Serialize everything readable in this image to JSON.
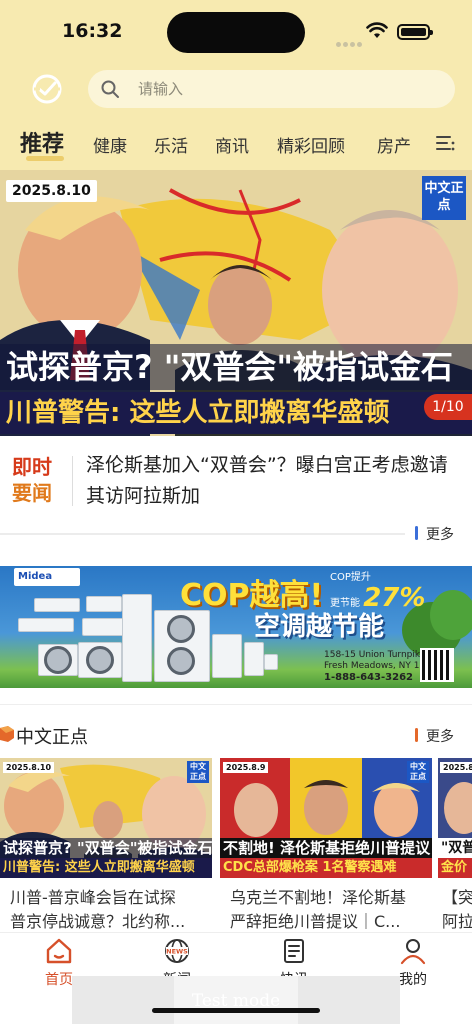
{
  "status_bar": {
    "time": "16:32"
  },
  "search": {
    "placeholder": "请输入"
  },
  "tabs": [
    {
      "label": "推荐",
      "active": true
    },
    {
      "label": "健康"
    },
    {
      "label": "乐活"
    },
    {
      "label": "商讯"
    },
    {
      "label": "精彩回顾"
    },
    {
      "label": "房产"
    }
  ],
  "hero": {
    "date": "2025.8.10",
    "brand": "中文正点",
    "title": "试探普京? \"双普会\"被指试金石",
    "subtitle": "川普警告: 这些人立即搬离华盛顿",
    "pager": "1/10"
  },
  "breaking": {
    "label_line1": "即时",
    "label_line2": "要闻",
    "text": "泽伦斯基加入“双普会”？曝白宫正考虑邀请其访阿拉斯加",
    "more": "更多"
  },
  "ad": {
    "brand": "Midea",
    "headline": "COP越高!",
    "pct_label": "COP提升",
    "pct_sub": "更节能",
    "pct": "27%",
    "sub": "空调越节能",
    "address_line1": "158-15 Union Turnpike",
    "address_line2": "Fresh Meadows, NY 11366",
    "phone": "1-888-643-3262"
  },
  "section": {
    "title": "中文正点",
    "more": "更多",
    "cards": [
      {
        "date": "2025.8.10",
        "brand": "中文正点",
        "cap1": "试探普京? \"双普会\"被指试金石",
        "cap2": "川普警告: 这些人立即搬离华盛顿",
        "title_line1": "川普-普京峰会旨在试探",
        "title_line2": "普京停战诚意？北约称..."
      },
      {
        "date": "2025.8.9",
        "brand": "中文正点",
        "cap1": "不割地! 泽伦斯基拒绝川普提议",
        "cap2": "CDC总部爆枪案 1名警察遇难",
        "title_line1": "乌克兰不割地！泽伦斯基",
        "title_line2": "严辞拒绝川普提议｜C..."
      },
      {
        "date": "2025.8",
        "brand": "中文正点",
        "cap1": "\"双普",
        "cap2": "金价",
        "title_line1": "【突",
        "title_line2": "阿拉"
      }
    ]
  },
  "bottom_nav": [
    {
      "label": "首页",
      "icon": "home-icon",
      "active": true
    },
    {
      "label": "新闻",
      "icon": "news-globe-icon"
    },
    {
      "label": "快讯",
      "icon": "flash-news-icon"
    },
    {
      "label": "我的",
      "icon": "profile-icon"
    }
  ],
  "test_mode": "Test mode",
  "colors": {
    "header_bg": "#f7eab0",
    "accent_red": "#d63a1a",
    "accent_orange": "#e07a1c",
    "active_nav": "#d6502a",
    "more_blue": "#3b6fd9"
  }
}
